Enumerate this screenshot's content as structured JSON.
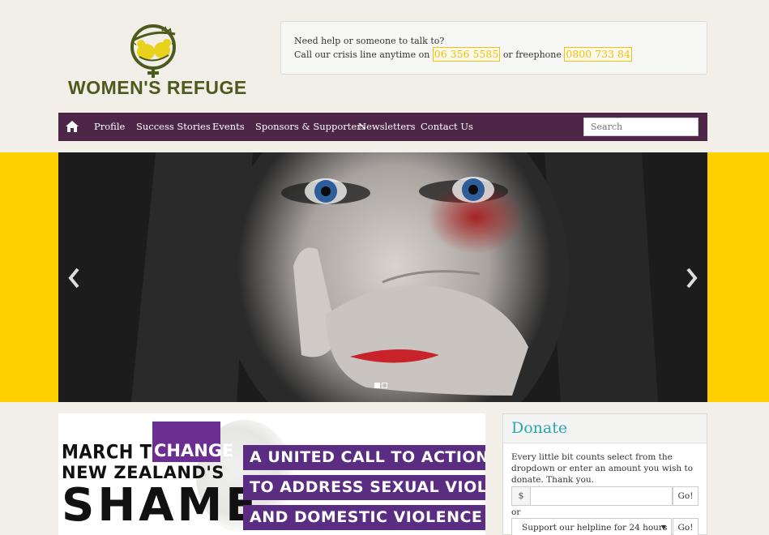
{
  "brand": {
    "name": "WOMEN'S REFUGE"
  },
  "crisis": {
    "line1": "Need help or someone to talk to?",
    "line2_prefix": "Call our crisis line anytime on",
    "phone1": "06 356 5585",
    "line2_middle": "or freephone",
    "phone2": "0800 733 84"
  },
  "nav": {
    "home_icon": "home-icon",
    "items": [
      "Profile",
      "Success Stories",
      "Events",
      "Sponsors & Supporters",
      "Newsletters",
      "Contact Us"
    ],
    "search_placeholder": "Search"
  },
  "slider": {
    "prev_icon": "chevron-left-icon",
    "next_icon": "chevron-right-icon",
    "slide_count": 2,
    "active_slide": 1
  },
  "banner": {
    "march_to": "MARCH TO",
    "change": "CHANGE",
    "new_zealands": "NEW ZEALAND'S",
    "shame": "SHAME",
    "call_lines": [
      "A UNITED CALL TO ACTION",
      "TO ADDRESS SEXUAL VIOLENCE",
      "AND DOMESTIC VIOLENCE"
    ]
  },
  "donate": {
    "title": "Donate",
    "text": "Every little bit counts select from the dropdown or enter an amount you wish to donate. Thank you.",
    "currency": "$",
    "go_label": "Go!",
    "or_label": "or",
    "select_value": "Support our helpline for 24 hours"
  },
  "colors": {
    "nav_bg": "#4e2748",
    "yellow": "#ffd000",
    "phone_yellow": "#f2c200",
    "donate_teal": "#2aa7b3",
    "banner_purple": "#5a2d82",
    "logo_green": "#4d5a1e"
  }
}
